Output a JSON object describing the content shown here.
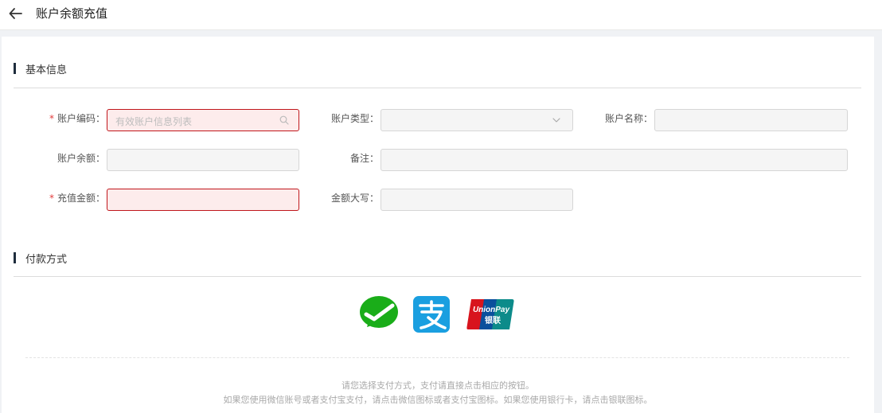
{
  "header": {
    "title": "账户余额充值",
    "back_icon": "arrow-left-icon"
  },
  "basic_info": {
    "section_title": "基本信息",
    "fields": {
      "account_code": {
        "label": "账户编码：",
        "placeholder": "有效账户信息列表",
        "required": true,
        "suffix_icon": "search-icon"
      },
      "account_type": {
        "label": "账户类型：",
        "value": "",
        "suffix_icon": "chevron-down-icon"
      },
      "account_name": {
        "label": "账户名称：",
        "value": ""
      },
      "account_balance": {
        "label": "账户余额：",
        "value": ""
      },
      "remark": {
        "label": "备注：",
        "value": ""
      },
      "recharge_amount": {
        "label": "充值金额：",
        "value": "",
        "required": true
      },
      "amount_uppercase": {
        "label": "金额大写：",
        "value": ""
      }
    },
    "required_mark": "*"
  },
  "payment": {
    "section_title": "付款方式",
    "methods": [
      {
        "name": "wechat-pay-icon",
        "color": "#1aad19"
      },
      {
        "name": "alipay-icon",
        "color": "#1a9fe0"
      },
      {
        "name": "unionpay-icon",
        "logo_text_top": "UnionPay",
        "logo_text_bottom": "银联",
        "colors": [
          "#d8141d",
          "#0a4f9c",
          "#0c8b8a"
        ]
      }
    ],
    "hint_line1": "请您选择支付方式，支付请直接点击相应的按钮。",
    "hint_line2": "如果您使用微信账号或者支付宝支付，请点击微信图标或者支付宝图标。如果您使用银行卡，请点击银联图标。"
  }
}
